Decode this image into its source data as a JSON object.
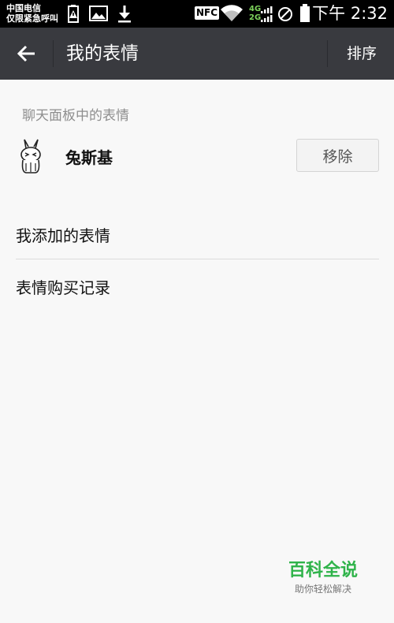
{
  "status_bar": {
    "carrier_line1": "中国电信",
    "carrier_line2": "仅限紧急呼叫",
    "nfc": "NFC",
    "net_4g": "4G",
    "net_2g": "2G",
    "time": "下午 2:32"
  },
  "title_bar": {
    "title": "我的表情",
    "sort_label": "排序"
  },
  "panel_section": {
    "label": "聊天面板中的表情",
    "items": [
      {
        "name": "兔斯基",
        "remove_label": "移除"
      }
    ]
  },
  "menu": [
    {
      "label": "我添加的表情"
    },
    {
      "label": "表情购买记录"
    }
  ],
  "watermark": {
    "title": "百科全说",
    "subtitle": "助你轻松解决"
  }
}
